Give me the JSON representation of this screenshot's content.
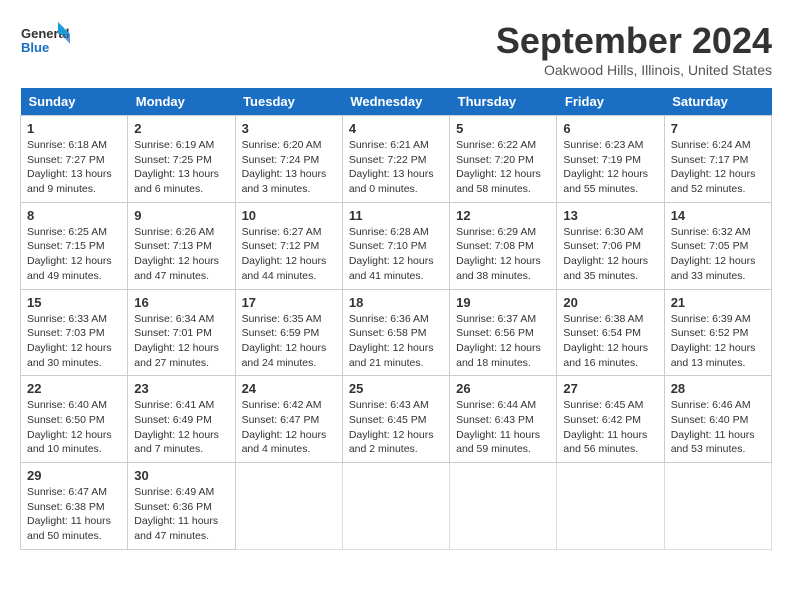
{
  "logo": {
    "line1": "General",
    "line2": "Blue"
  },
  "title": "September 2024",
  "location": "Oakwood Hills, Illinois, United States",
  "weekdays": [
    "Sunday",
    "Monday",
    "Tuesday",
    "Wednesday",
    "Thursday",
    "Friday",
    "Saturday"
  ],
  "weeks": [
    [
      {
        "day": "1",
        "sunrise": "6:18 AM",
        "sunset": "7:27 PM",
        "daylight": "13 hours and 9 minutes."
      },
      {
        "day": "2",
        "sunrise": "6:19 AM",
        "sunset": "7:25 PM",
        "daylight": "13 hours and 6 minutes."
      },
      {
        "day": "3",
        "sunrise": "6:20 AM",
        "sunset": "7:24 PM",
        "daylight": "13 hours and 3 minutes."
      },
      {
        "day": "4",
        "sunrise": "6:21 AM",
        "sunset": "7:22 PM",
        "daylight": "13 hours and 0 minutes."
      },
      {
        "day": "5",
        "sunrise": "6:22 AM",
        "sunset": "7:20 PM",
        "daylight": "12 hours and 58 minutes."
      },
      {
        "day": "6",
        "sunrise": "6:23 AM",
        "sunset": "7:19 PM",
        "daylight": "12 hours and 55 minutes."
      },
      {
        "day": "7",
        "sunrise": "6:24 AM",
        "sunset": "7:17 PM",
        "daylight": "12 hours and 52 minutes."
      }
    ],
    [
      {
        "day": "8",
        "sunrise": "6:25 AM",
        "sunset": "7:15 PM",
        "daylight": "12 hours and 49 minutes."
      },
      {
        "day": "9",
        "sunrise": "6:26 AM",
        "sunset": "7:13 PM",
        "daylight": "12 hours and 47 minutes."
      },
      {
        "day": "10",
        "sunrise": "6:27 AM",
        "sunset": "7:12 PM",
        "daylight": "12 hours and 44 minutes."
      },
      {
        "day": "11",
        "sunrise": "6:28 AM",
        "sunset": "7:10 PM",
        "daylight": "12 hours and 41 minutes."
      },
      {
        "day": "12",
        "sunrise": "6:29 AM",
        "sunset": "7:08 PM",
        "daylight": "12 hours and 38 minutes."
      },
      {
        "day": "13",
        "sunrise": "6:30 AM",
        "sunset": "7:06 PM",
        "daylight": "12 hours and 35 minutes."
      },
      {
        "day": "14",
        "sunrise": "6:32 AM",
        "sunset": "7:05 PM",
        "daylight": "12 hours and 33 minutes."
      }
    ],
    [
      {
        "day": "15",
        "sunrise": "6:33 AM",
        "sunset": "7:03 PM",
        "daylight": "12 hours and 30 minutes."
      },
      {
        "day": "16",
        "sunrise": "6:34 AM",
        "sunset": "7:01 PM",
        "daylight": "12 hours and 27 minutes."
      },
      {
        "day": "17",
        "sunrise": "6:35 AM",
        "sunset": "6:59 PM",
        "daylight": "12 hours and 24 minutes."
      },
      {
        "day": "18",
        "sunrise": "6:36 AM",
        "sunset": "6:58 PM",
        "daylight": "12 hours and 21 minutes."
      },
      {
        "day": "19",
        "sunrise": "6:37 AM",
        "sunset": "6:56 PM",
        "daylight": "12 hours and 18 minutes."
      },
      {
        "day": "20",
        "sunrise": "6:38 AM",
        "sunset": "6:54 PM",
        "daylight": "12 hours and 16 minutes."
      },
      {
        "day": "21",
        "sunrise": "6:39 AM",
        "sunset": "6:52 PM",
        "daylight": "12 hours and 13 minutes."
      }
    ],
    [
      {
        "day": "22",
        "sunrise": "6:40 AM",
        "sunset": "6:50 PM",
        "daylight": "12 hours and 10 minutes."
      },
      {
        "day": "23",
        "sunrise": "6:41 AM",
        "sunset": "6:49 PM",
        "daylight": "12 hours and 7 minutes."
      },
      {
        "day": "24",
        "sunrise": "6:42 AM",
        "sunset": "6:47 PM",
        "daylight": "12 hours and 4 minutes."
      },
      {
        "day": "25",
        "sunrise": "6:43 AM",
        "sunset": "6:45 PM",
        "daylight": "12 hours and 2 minutes."
      },
      {
        "day": "26",
        "sunrise": "6:44 AM",
        "sunset": "6:43 PM",
        "daylight": "11 hours and 59 minutes."
      },
      {
        "day": "27",
        "sunrise": "6:45 AM",
        "sunset": "6:42 PM",
        "daylight": "11 hours and 56 minutes."
      },
      {
        "day": "28",
        "sunrise": "6:46 AM",
        "sunset": "6:40 PM",
        "daylight": "11 hours and 53 minutes."
      }
    ],
    [
      {
        "day": "29",
        "sunrise": "6:47 AM",
        "sunset": "6:38 PM",
        "daylight": "11 hours and 50 minutes."
      },
      {
        "day": "30",
        "sunrise": "6:49 AM",
        "sunset": "6:36 PM",
        "daylight": "11 hours and 47 minutes."
      },
      null,
      null,
      null,
      null,
      null
    ]
  ]
}
